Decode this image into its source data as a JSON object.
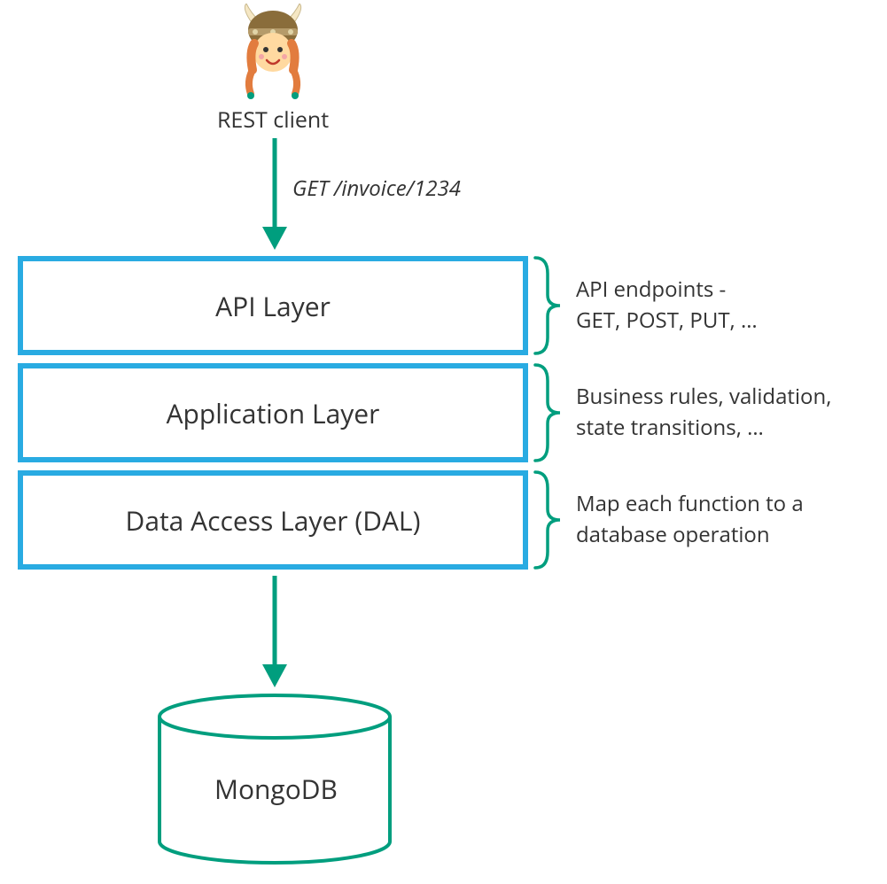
{
  "client_label": "REST client",
  "request_label": "GET /invoice/1234",
  "layers": [
    {
      "title": "API Layer",
      "note": "API endpoints -\nGET, POST, PUT, …"
    },
    {
      "title": "Application Layer",
      "note": "Business rules, validation,\nstate transitions, …"
    },
    {
      "title": "Data Access Layer (DAL)",
      "note": "Map each function to a\ndatabase operation"
    }
  ],
  "database_label": "MongoDB",
  "colors": {
    "box_border": "#29abe2",
    "accent": "#009e7e",
    "text": "#333333"
  }
}
